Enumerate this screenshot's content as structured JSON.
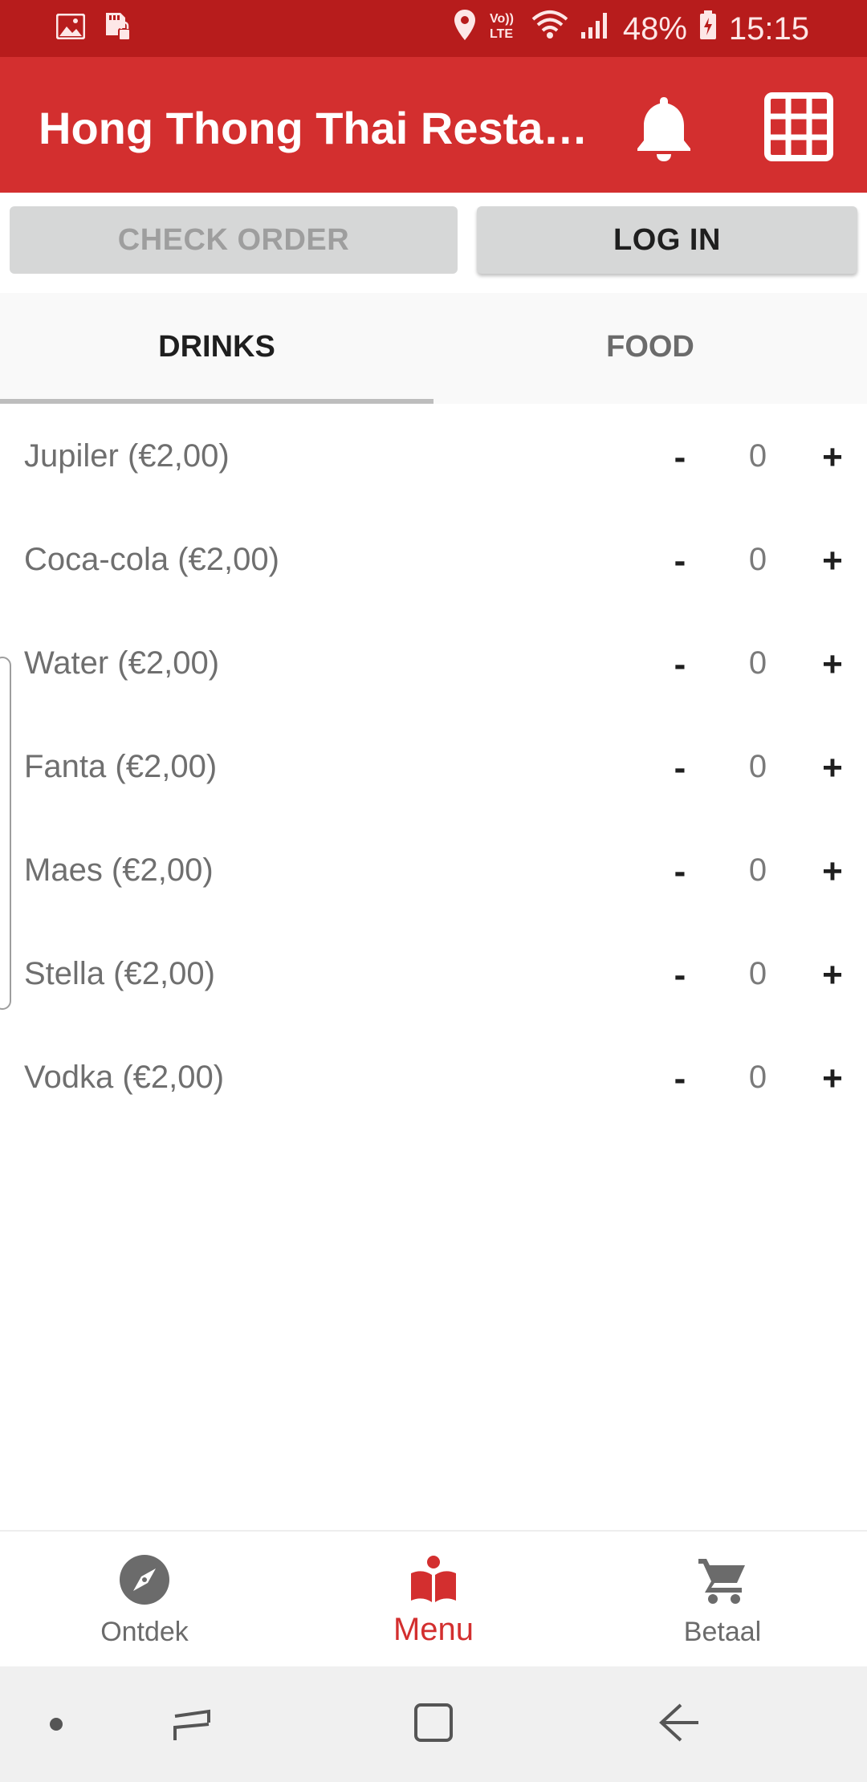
{
  "status_bar": {
    "battery": "48%",
    "time": "15:15",
    "icons": [
      "gallery-icon",
      "sd-card-icon",
      "location-icon",
      "volte-icon",
      "wifi-icon",
      "signal-icon",
      "battery-icon"
    ]
  },
  "app_bar": {
    "title": "Hong Thong Thai Resta…",
    "icons": [
      "bell-icon",
      "grid-icon"
    ]
  },
  "actions": {
    "check_order": "CHECK ORDER",
    "log_in": "LOG IN"
  },
  "tabs": [
    {
      "label": "DRINKS",
      "active": true
    },
    {
      "label": "FOOD",
      "active": false
    }
  ],
  "items": [
    {
      "label": "Jupiler (€2,00)",
      "qty": "0",
      "minus": "-",
      "plus": "+"
    },
    {
      "label": "Coca-cola (€2,00)",
      "qty": "0",
      "minus": "-",
      "plus": "+"
    },
    {
      "label": "Water (€2,00)",
      "qty": "0",
      "minus": "-",
      "plus": "+"
    },
    {
      "label": "Fanta (€2,00)",
      "qty": "0",
      "minus": "-",
      "plus": "+"
    },
    {
      "label": "Maes (€2,00)",
      "qty": "0",
      "minus": "-",
      "plus": "+"
    },
    {
      "label": "Stella (€2,00)",
      "qty": "0",
      "minus": "-",
      "plus": "+"
    },
    {
      "label": "Vodka (€2,00)",
      "qty": "0",
      "minus": "-",
      "plus": "+"
    }
  ],
  "bottom_nav": [
    {
      "label": "Ontdek",
      "icon": "compass-icon",
      "active": false
    },
    {
      "label": "Menu",
      "icon": "menu-book-icon",
      "active": true
    },
    {
      "label": "Betaal",
      "icon": "cart-icon",
      "active": false
    }
  ],
  "colors": {
    "primary": "#d32f2f",
    "status_bar": "#b71c1c",
    "active_nav": "#d32f2f"
  }
}
